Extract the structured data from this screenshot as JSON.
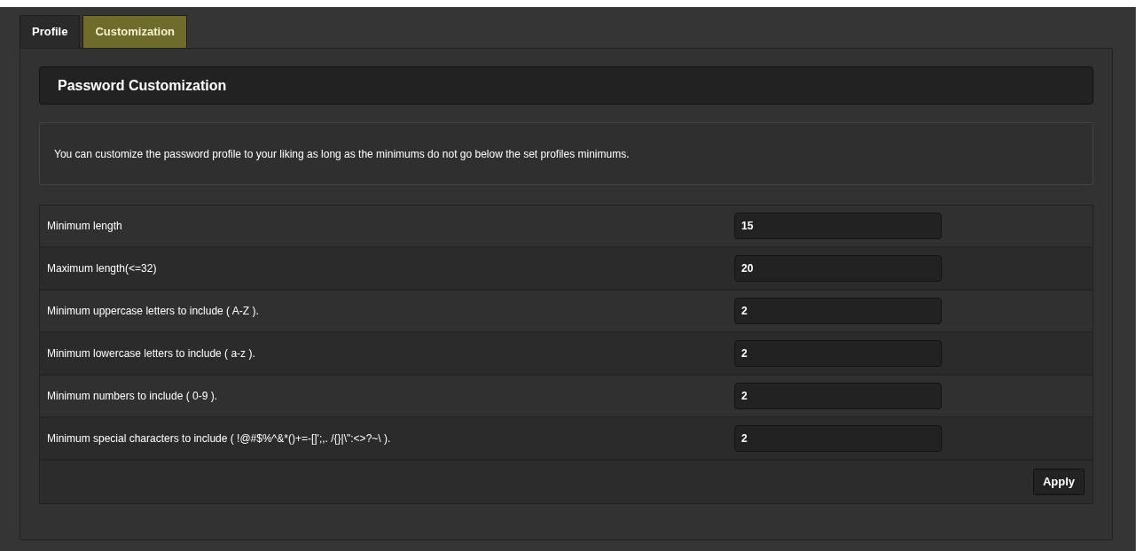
{
  "tabs": [
    {
      "label": "Profile",
      "selected": false
    },
    {
      "label": "Customization",
      "selected": true
    }
  ],
  "header": {
    "title": "Password Customization"
  },
  "description": "You can customize the password profile to your liking as long as the minimums do not go below the set profiles minimums.",
  "settings": [
    {
      "label": "Minimum length",
      "value": "15"
    },
    {
      "label": "Maximum length(<=32)",
      "value": "20"
    },
    {
      "label": "Minimum uppercase letters to include ( A-Z ).",
      "value": "2"
    },
    {
      "label": "Minimum lowercase letters to include ( a-z ).",
      "value": "2"
    },
    {
      "label": "Minimum numbers to include ( 0-9 ).",
      "value": "2"
    },
    {
      "label": "Minimum special characters to include ( !@#$%^&*()+=-[]';,. /{}|\\\":<>?~\\ ).",
      "value": "2"
    }
  ],
  "apply_button": "Apply"
}
